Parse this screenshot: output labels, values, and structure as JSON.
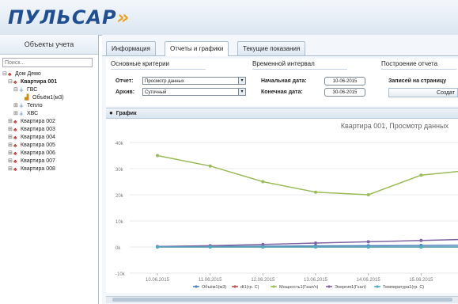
{
  "header": {
    "logo": "ПУЛЬСАР"
  },
  "sidebar": {
    "title": "Объекты учета",
    "search_placeholder": "Поиск...",
    "tree": [
      {
        "label": "Дом Демо",
        "level": 0,
        "toggle": "⊟",
        "icon": "house",
        "bold": false
      },
      {
        "label": "Квартира 001",
        "level": 1,
        "toggle": "⊟",
        "icon": "house",
        "bold": true
      },
      {
        "label": "ГВС",
        "level": 2,
        "toggle": "⊟",
        "icon": "system",
        "bold": false
      },
      {
        "label": "Объём1(м3)",
        "level": 3,
        "toggle": "",
        "icon": "chart",
        "bold": false
      },
      {
        "label": "Тепло",
        "level": 2,
        "toggle": "⊞",
        "icon": "system",
        "bold": false
      },
      {
        "label": "ХВС",
        "level": 2,
        "toggle": "⊞",
        "icon": "system",
        "bold": false
      },
      {
        "label": "Квартира 002",
        "level": 1,
        "toggle": "⊞",
        "icon": "house",
        "bold": false
      },
      {
        "label": "Квартира 003",
        "level": 1,
        "toggle": "⊞",
        "icon": "house",
        "bold": false
      },
      {
        "label": "Квартира 004",
        "level": 1,
        "toggle": "⊞",
        "icon": "house",
        "bold": false
      },
      {
        "label": "Квартира 005",
        "level": 1,
        "toggle": "⊞",
        "icon": "house",
        "bold": false
      },
      {
        "label": "Квартира 006",
        "level": 1,
        "toggle": "⊞",
        "icon": "house",
        "bold": false
      },
      {
        "label": "Квартира 007",
        "level": 1,
        "toggle": "⊞",
        "icon": "house",
        "bold": false
      },
      {
        "label": "Квартира 008",
        "level": 1,
        "toggle": "⊞",
        "icon": "house",
        "bold": false
      }
    ]
  },
  "tabs": [
    {
      "label": "Информация",
      "active": false
    },
    {
      "label": "Отчеты и графики",
      "active": true
    },
    {
      "label": "Текущие показания",
      "active": false
    }
  ],
  "criteria": {
    "section_main": "Основные критерии",
    "section_time": "Временной интервал",
    "section_report": "Построение отчета",
    "report_label": "Отчет:",
    "report_value": "Просмотр данных",
    "archive_label": "Архив:",
    "archive_value": "Суточный",
    "start_label": "Начальная дата:",
    "start_value": "10-06-2015",
    "end_label": "Конечная дата:",
    "end_value": "30-06-2015",
    "records_label": "Записей на страницу",
    "create_button": "Создат"
  },
  "graph_panel": {
    "label": "График"
  },
  "chart_data": {
    "type": "line",
    "title": "Квартира 001, Просмотр данных",
    "categories": [
      "10.06.2015",
      "11.06.2015",
      "12.06.2015",
      "13.06.2015",
      "14.06.2015",
      "15.06.2015"
    ],
    "ylim": [
      -10,
      40
    ],
    "yticks": [
      "40k",
      "30k",
      "20k",
      "10k",
      "0k",
      "-10k"
    ],
    "series": [
      {
        "name": "Объём1(м3)",
        "color": "#4f81bd",
        "values": [
          0.1,
          0.2,
          0.3,
          0.4,
          0.5,
          0.6,
          0.7
        ]
      },
      {
        "name": "dt1(гр. С)",
        "color": "#c0504d",
        "values": [
          0.0,
          0.0,
          0.0,
          0.0,
          0.0,
          0.0,
          0.0
        ]
      },
      {
        "name": "Мощность1(Гкал/ч)",
        "color": "#9bbb59",
        "values": [
          35,
          31,
          25,
          21,
          20,
          27.5,
          29.5
        ]
      },
      {
        "name": "Энергия1(Гкал)",
        "color": "#8064a2",
        "values": [
          0.2,
          0.5,
          1.0,
          1.5,
          2.0,
          2.5,
          3.0
        ]
      },
      {
        "name": "Температура1(гр. С)",
        "color": "#4bacc6",
        "values": [
          0.0,
          0.0,
          0.0,
          0.0,
          0.0,
          0.0,
          0.0
        ]
      }
    ]
  }
}
